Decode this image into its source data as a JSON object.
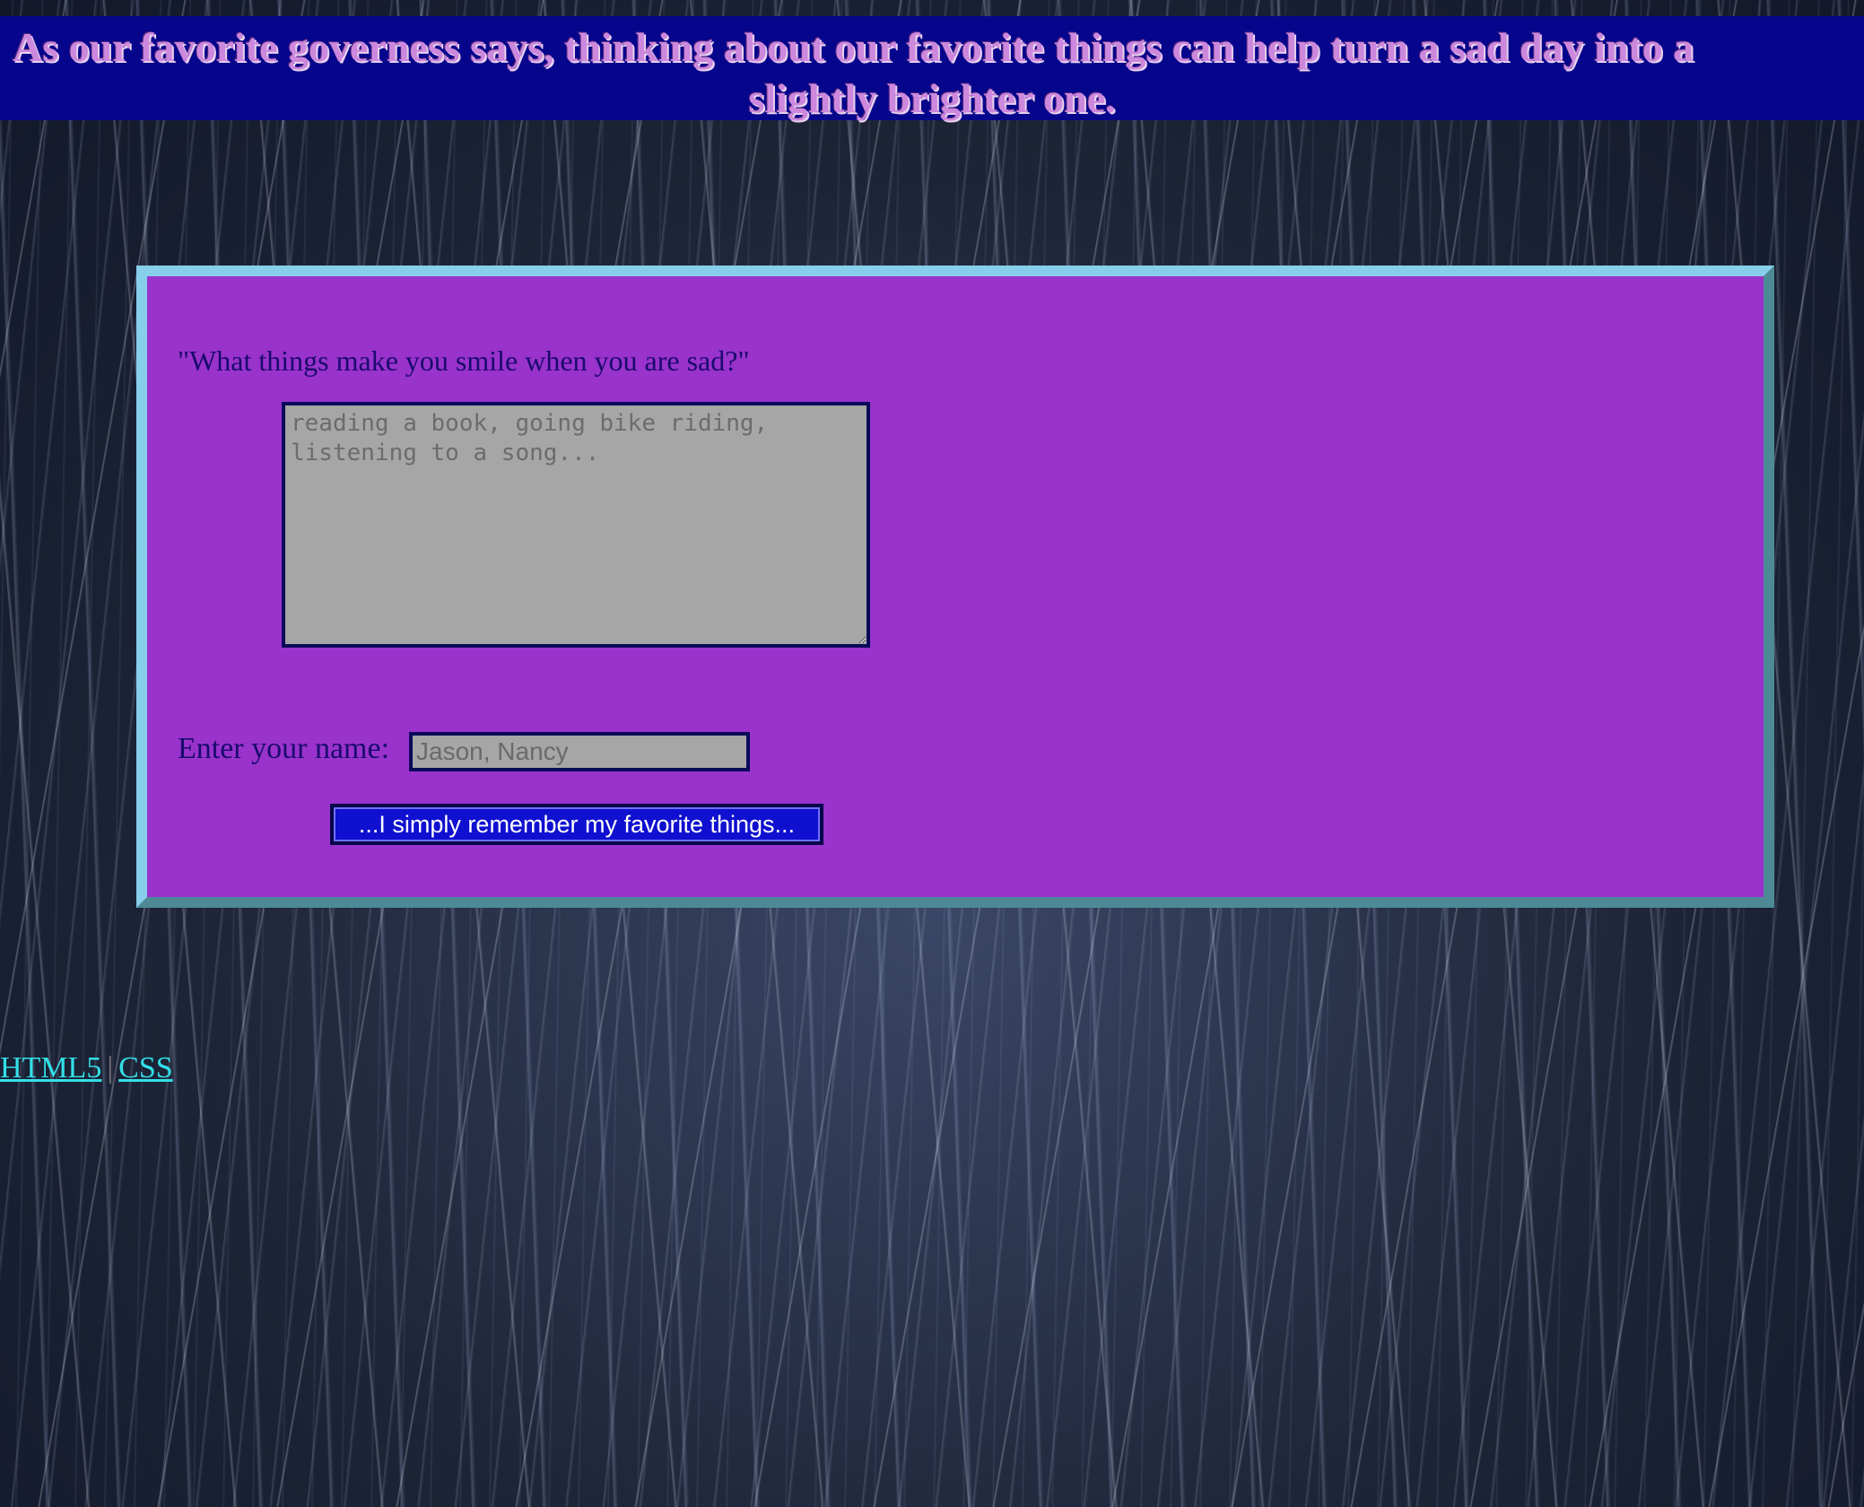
{
  "banner": {
    "line1": "As our favorite governess says, thinking about our favorite things can help turn a sad day into a",
    "line2": "slightly brighter one."
  },
  "form": {
    "question": "\"What things make you smile when you are sad?\"",
    "textarea_placeholder": "reading a book, going bike riding, listening to a song...",
    "name_label": "Enter your name:",
    "name_placeholder": "Jason, Nancy",
    "submit_label": "...I simply remember my favorite things..."
  },
  "footer": {
    "links": [
      "HTML5",
      "CSS"
    ],
    "separator": "|"
  },
  "colors": {
    "banner_bg": "#06068c",
    "banner_text": "#cc88dd",
    "panel_bg": "#9933cc",
    "panel_border": "#87ceeb",
    "input_bg": "#a6a6a6",
    "button_bg": "#1010d0",
    "link": "#33e0e8"
  }
}
